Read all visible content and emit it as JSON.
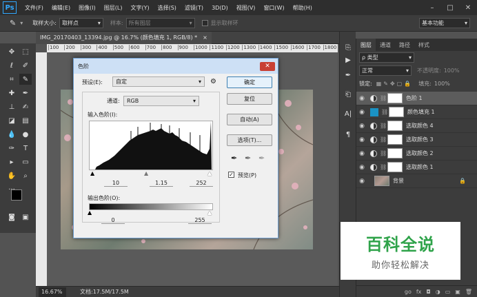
{
  "app": {
    "logo": "Ps",
    "menu": [
      "文件(F)",
      "编辑(E)",
      "图像(I)",
      "图层(L)",
      "文字(Y)",
      "选择(S)",
      "滤镜(T)",
      "3D(D)",
      "视图(V)",
      "窗口(W)",
      "帮助(H)"
    ],
    "window_controls": [
      "–",
      "□",
      "✕"
    ]
  },
  "options_bar": {
    "sample_size_label": "取样大小:",
    "sample_size_value": "取样点",
    "sample_label": "样本:",
    "sample_value": "所有图层",
    "show_ring_label": "显示取样环",
    "workspace": "基本功能"
  },
  "document": {
    "tab_title": "IMG_20170403_13394.jpg @ 16.7% (颜色填充 1, RGB/8) *",
    "tab_close": "×",
    "ruler_ticks": [
      "100",
      "200",
      "300",
      "400",
      "500",
      "600",
      "700",
      "800",
      "900",
      "1000",
      "1100",
      "1200",
      "1300",
      "1400",
      "1500",
      "1600",
      "1700",
      "1800"
    ],
    "zoom": "16.67%",
    "doc_info": "文档:17.5M/17.5M"
  },
  "dialog": {
    "title": "色阶",
    "close": "✕",
    "preset_label": "预设(E):",
    "preset_value": "自定",
    "channel_label": "通道:",
    "channel_value": "RGB",
    "input_levels_label": "输入色阶(I):",
    "input_black": "10",
    "input_gamma": "1.15",
    "input_white": "252",
    "output_levels_label": "输出色阶(O):",
    "output_black": "0",
    "output_white": "255",
    "buttons": {
      "ok": "确定",
      "reset": "复位",
      "auto": "自动(A)",
      "options": "选项(T)..."
    },
    "preview_label": "预览(P)",
    "preview_checked": true
  },
  "layers_panel": {
    "tabs": [
      "图层",
      "通道",
      "路径",
      "样式"
    ],
    "filter_label": "ρ 类型",
    "blend_mode": "正常",
    "opacity_label": "不透明度:",
    "opacity_value": "100%",
    "lock_label": "锁定:",
    "fill_label": "填充:",
    "fill_value": "100%",
    "layers": [
      {
        "name": "色阶 1",
        "type": "adjustment",
        "selected": true
      },
      {
        "name": "颜色填充 1",
        "type": "fill",
        "selected": false
      },
      {
        "name": "选取颜色 4",
        "type": "adjustment",
        "selected": false
      },
      {
        "name": "选取颜色 3",
        "type": "adjustment",
        "selected": false
      },
      {
        "name": "选取颜色 2",
        "type": "adjustment",
        "selected": false
      },
      {
        "name": "选取颜色 1",
        "type": "adjustment",
        "selected": false
      },
      {
        "name": "背景",
        "type": "background",
        "selected": false
      }
    ],
    "bottom_icons": [
      "go",
      "fx",
      "◘",
      "◑",
      "▭",
      "▣",
      "🗑"
    ]
  },
  "watermark": {
    "title": "百科全说",
    "subtitle": "助你轻松解决"
  },
  "colors": {
    "accent": "#31a8ff",
    "fill_layer": "#1a92c4",
    "watermark_green": "#2fa34a"
  }
}
